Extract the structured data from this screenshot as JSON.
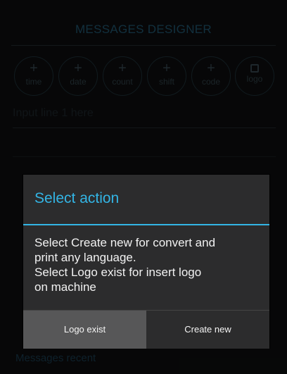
{
  "header": {
    "title": "MESSAGES DESIGNER"
  },
  "insert_buttons": [
    {
      "symbol": "+",
      "label": "time",
      "icon": "plus-icon"
    },
    {
      "symbol": "+",
      "label": "date",
      "icon": "plus-icon"
    },
    {
      "symbol": "+",
      "label": "count",
      "icon": "plus-icon"
    },
    {
      "symbol": "+",
      "label": "shift",
      "icon": "plus-icon"
    },
    {
      "symbol": "+",
      "label": "code",
      "icon": "plus-icon"
    },
    {
      "symbol": "",
      "label": "logo",
      "icon": "image-icon"
    }
  ],
  "input": {
    "placeholder": "Input line 1 here"
  },
  "dialog": {
    "title": "Select action",
    "message_lines": [
      "Select Create new for convert and",
      "print any language.",
      "Select Logo exist for insert logo",
      "on machine"
    ],
    "buttons": {
      "left": "Logo exist",
      "right": "Create new"
    }
  },
  "footer": {
    "recent_label": "Messages recent"
  },
  "colors": {
    "accent": "#33b5e5",
    "dialog_bg": "#2c2c2d",
    "pressed_button": "#575758"
  }
}
